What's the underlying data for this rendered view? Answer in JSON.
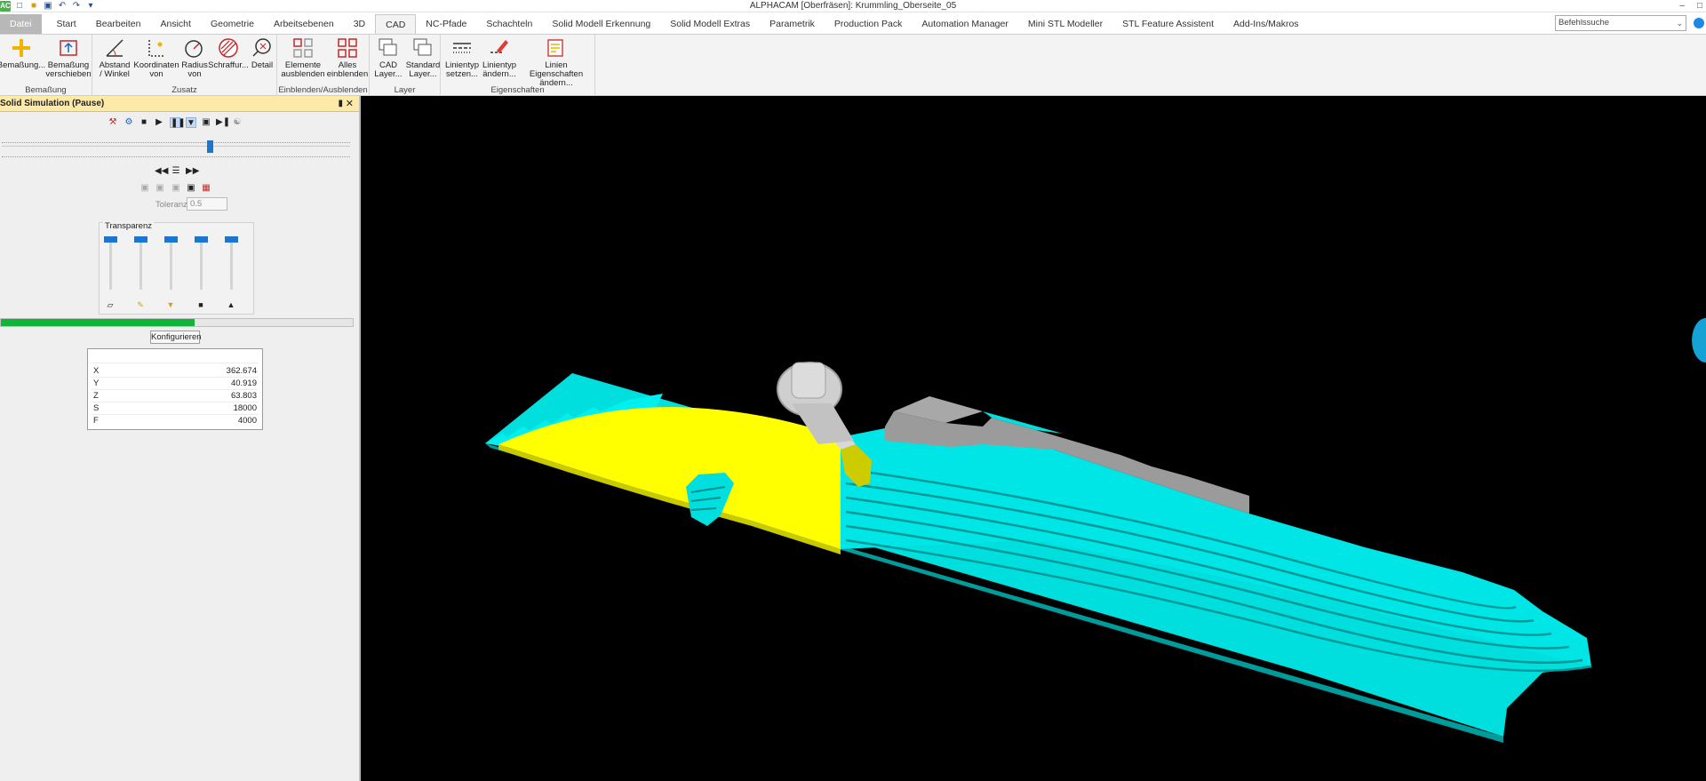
{
  "window": {
    "title": "ALPHACAM [Oberfräsen]: Krummling_Oberseite_05",
    "app_icon": "AC"
  },
  "tabs": [
    "Datei",
    "Start",
    "Bearbeiten",
    "Ansicht",
    "Geometrie",
    "Arbeitsebenen",
    "3D",
    "CAD",
    "NC-Pfade",
    "Schachteln",
    "Solid Modell Erkennung",
    "Solid Modell Extras",
    "Parametrik",
    "Production Pack",
    "Automation Manager",
    "Mini STL Modeller",
    "STL Feature Assistent",
    "Add-Ins/Makros"
  ],
  "active_tab": "CAD",
  "command_search": {
    "value": "Befehlssuche"
  },
  "ribbon": {
    "groups": {
      "bemassung": "Bemaßung",
      "zusatz": "Zusatz",
      "einblenden": "Einblenden/Ausblenden",
      "layer": "Layer",
      "eigenschaften": "Eigenschaften"
    },
    "buttons": {
      "bemassung_1": "Bemaßung...",
      "bemassung_verschieben_1": "Bemaßung",
      "bemassung_verschieben_2": "verschieben",
      "abstand_1": "Abstand",
      "abstand_2": "/ Winkel",
      "koordinaten_1": "Koordinaten",
      "koordinaten_2": "von",
      "radius_1": "Radius",
      "radius_2": "von",
      "schraffur": "Schraffur...",
      "detail": "Detail",
      "elemente_1": "Elemente",
      "elemente_2": "ausblenden",
      "alles_1": "Alles",
      "alles_2": "einblenden",
      "cad_layer_1": "CAD",
      "cad_layer_2": "Layer...",
      "std_layer_1": "Standard",
      "std_layer_2": "Layer...",
      "linientyp_setzen_1": "Linientyp",
      "linientyp_setzen_2": "setzen...",
      "linientyp_aendern_1": "Linientyp",
      "linientyp_aendern_2": "ändern...",
      "linien_eig_1": "Linien Eigenschaften",
      "linien_eig_2": "ändern..."
    }
  },
  "panel": {
    "title": "Solid Simulation (Pause)",
    "tolerance_label": "Toleranz",
    "tolerance_value": "0.5",
    "transparency_label": "Transparenz",
    "progress": 0.55,
    "configure_label": "Konfigurieren",
    "coords": [
      {
        "k": "X",
        "v": "362.674"
      },
      {
        "k": "Y",
        "v": "40.919"
      },
      {
        "k": "Z",
        "v": "63.803"
      },
      {
        "k": "S",
        "v": "18000"
      },
      {
        "k": "F",
        "v": "4000"
      }
    ]
  },
  "colors": {
    "workpiece": "#00e5e5",
    "machined": "#ffff00",
    "stock": "#9a9a9a",
    "tool": "#c8c8c8",
    "accent": "#1976d2",
    "progress": "#12b33a"
  }
}
